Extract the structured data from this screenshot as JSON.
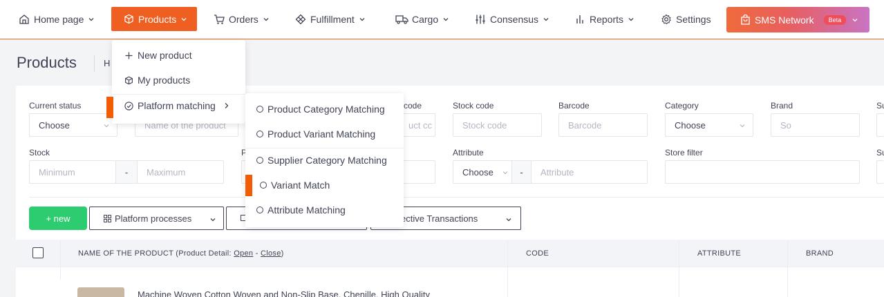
{
  "nav": {
    "home": "Home page",
    "products": "Products",
    "orders": "Orders",
    "fulfillment": "Fulfillment",
    "cargo": "Cargo",
    "consensus": "Consensus",
    "reports": "Reports",
    "settings": "Settings",
    "sms": "SMS Network",
    "beta": "Beta"
  },
  "page": {
    "title": "Products",
    "breadcrumb": "H"
  },
  "products_menu": {
    "new_product": "New product",
    "my_products": "My products",
    "platform_matching": "Platform matching"
  },
  "matching_menu": {
    "items": [
      "Product Category Matching",
      "Product Variant Matching",
      "Supplier Category Matching",
      "Variant Match",
      "Attribute Matching"
    ]
  },
  "filters": {
    "current_status": {
      "label": "Current status",
      "value": "Choose"
    },
    "product_name": {
      "placeholder": "Name of the product"
    },
    "code": {
      "label": "code",
      "placeholder": "uct cc"
    },
    "stock_code": {
      "label": "Stock code",
      "placeholder": "Stock code"
    },
    "barcode": {
      "label": "Barcode",
      "placeholder": "Barcode"
    },
    "category": {
      "label": "Category",
      "value": "Choose"
    },
    "brand": {
      "label": "Brand",
      "placeholder": "So"
    },
    "supplier_cut": {
      "label": "Su"
    },
    "stock": {
      "label": "Stock",
      "min_placeholder": "Minimum",
      "sep": "-",
      "max_placeholder": "Maximum"
    },
    "price_cut": {
      "label": "P"
    },
    "attribute": {
      "label": "Attribute",
      "value": "Choose",
      "sep": "-",
      "placeholder": "Attribute"
    },
    "store_filter": {
      "label": "Store filter"
    },
    "supplier_cut2": {
      "label": "Su"
    }
  },
  "actions": {
    "new": "+ new",
    "platform_processes": "Platform processes",
    "collective": "ollective Transactions"
  },
  "table": {
    "col_name_prefix": "NAME OF THE PRODUCT (Product Detail: ",
    "col_open": "Open",
    "col_dash": " - ",
    "col_close": "Close",
    "col_name_suffix": ")",
    "col_code": "CODE",
    "col_attribute": "ATTRIBUTE",
    "col_brand": "BRAND",
    "rows": [
      {
        "name": "Machine Woven Cotton Woven and Non-Slip Base, Chenille, High Quality"
      }
    ]
  },
  "colors": {
    "accent": "#ef5f22",
    "success": "#2ecc71",
    "beta": "#f04d5b"
  }
}
